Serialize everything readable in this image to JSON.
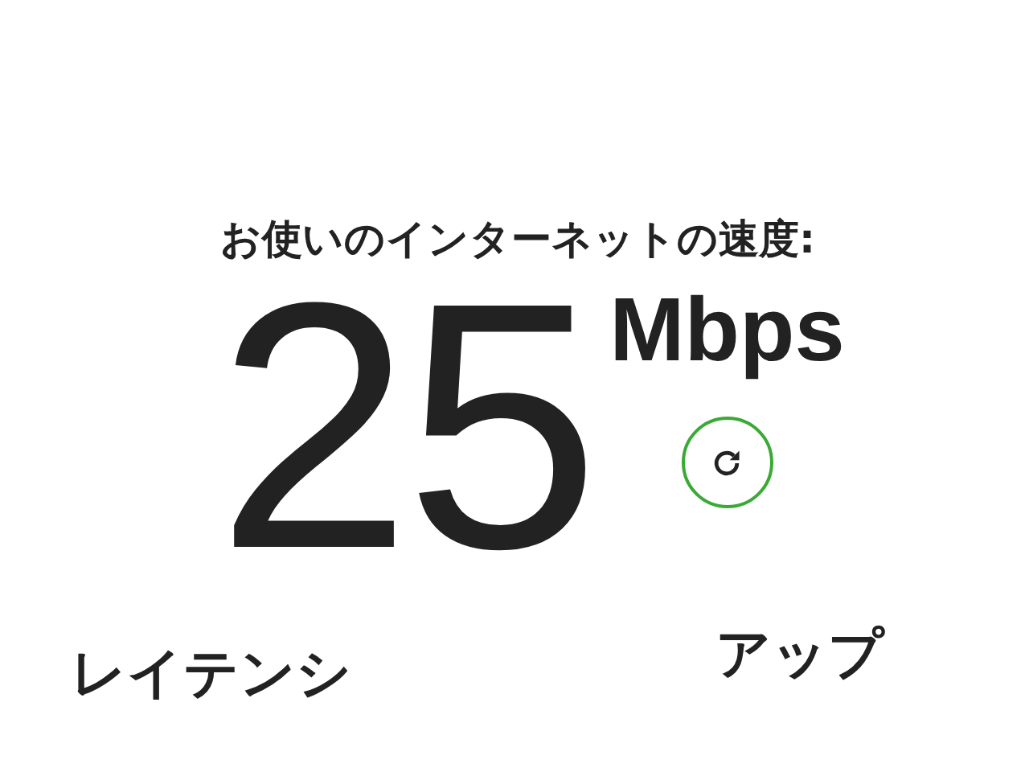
{
  "heading": "お使いのインターネットの速度:",
  "speed": {
    "value": "25",
    "unit": "Mbps"
  },
  "stats": [
    {
      "label": "レイテンシ"
    },
    {
      "label": "アップ"
    }
  ]
}
